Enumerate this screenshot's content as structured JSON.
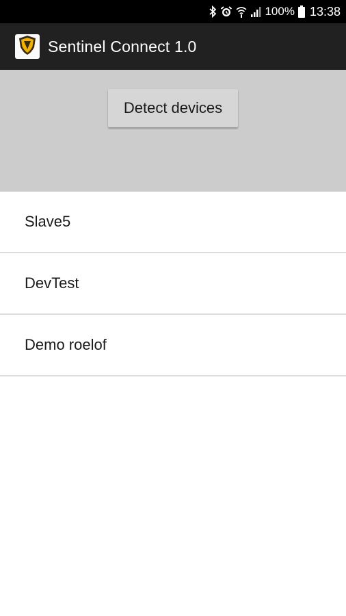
{
  "status_bar": {
    "battery": "100%",
    "time": "13:38",
    "icons": [
      "bluetooth-icon",
      "alarm-icon",
      "wifi-icon",
      "signal-icon",
      "battery-icon"
    ]
  },
  "app_bar": {
    "title": "Sentinel Connect 1.0",
    "logo_icon": "shield-icon",
    "colors": {
      "background": "#212121",
      "shield": "#f0b400"
    }
  },
  "actions": {
    "detect_label": "Detect devices"
  },
  "devices": [
    {
      "name": "Slave5"
    },
    {
      "name": "DevTest"
    },
    {
      "name": "Demo roelof"
    }
  ]
}
